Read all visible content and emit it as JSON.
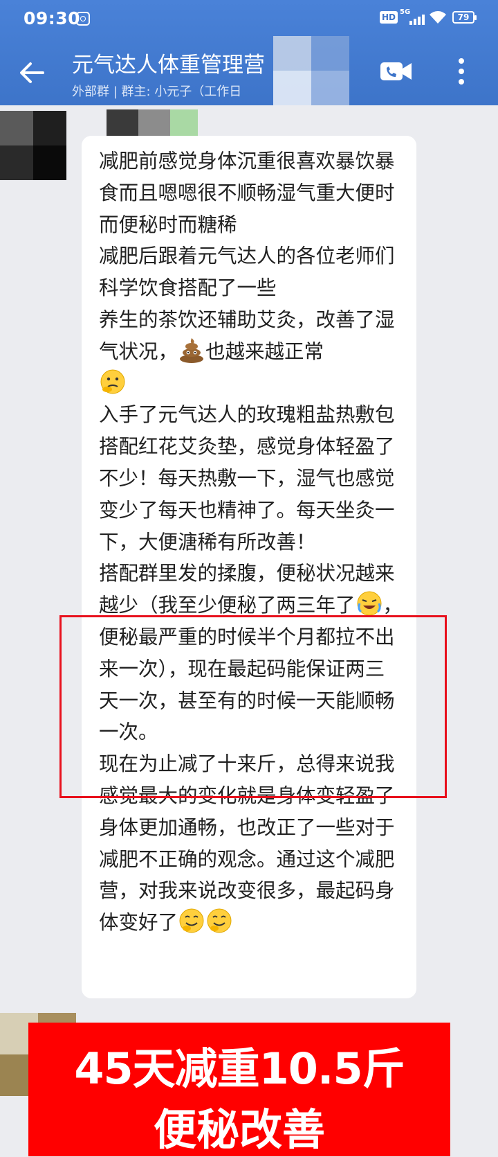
{
  "status_bar": {
    "time": "09:30",
    "network": "5G",
    "battery": "79",
    "hd": "HD"
  },
  "header": {
    "title": "元气达人体重管理营",
    "subtitle": "外部群 | 群主: 小元子（工作日"
  },
  "message": {
    "paragraphs": {
      "p1": "减肥前感觉身体沉重很喜欢暴饮暴食而且嗯嗯很不顺畅湿气重大便时而便秘时而糖稀",
      "p2": "减肥后跟着元气达人的各位老师们科学饮食搭配了一些",
      "p3a": "养生的茶饮还辅助艾灸，改善了湿气状况，",
      "p3b": "也越来越正常",
      "p4": "入手了元气达人的玫瑰粗盐热敷包搭配红花艾灸垫，感觉身体轻盈了不少！每天热敷一下，湿气也感觉变少了每天也精神了。每天坐灸一下，大便溏稀有所改善！",
      "p5a": "搭配群里发的揉腹，便秘状况越来越少（我至少便秘了两三年了",
      "p5b": "，便秘最严重的时候半个月都拉不出来一次），现在最起码能保证两三天一次，甚至有的时候一天能顺畅一次。",
      "p6": "现在为止减了十来斤，总得来说我感觉最大的变化就是身体变轻盈了身体更加通畅，也改正了一些对于减肥不正确的观念。通过这个减肥营，对我来说改变很多，最起码身体变好了"
    },
    "emojis": [
      "poop-emoji",
      "thinking-emoji",
      "crying-laughing-emoji",
      "grin-emoji",
      "grin-emoji"
    ]
  },
  "banner": {
    "line1": "45天减重10.5斤",
    "line2": "便秘改善"
  },
  "colors": {
    "header_blue": "#3d74c9",
    "highlight_red": "#e8101c",
    "banner_red": "#ff0000",
    "background": "#ebecf0"
  }
}
